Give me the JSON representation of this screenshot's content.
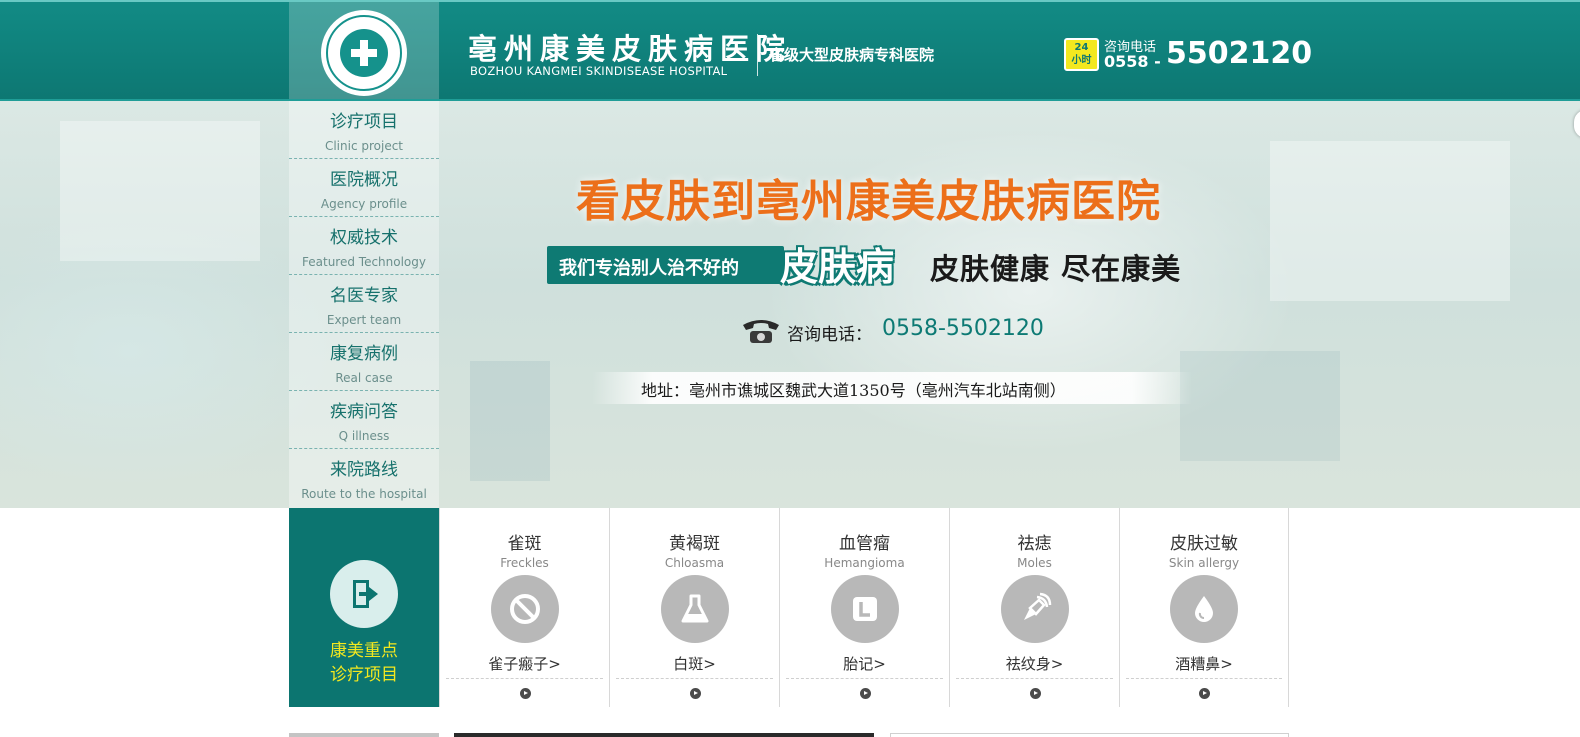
{
  "header": {
    "title_cn": "亳州康美皮肤病医院",
    "title_en": "BOZHOU KANGMEI SKINDISEASE HOSPITAL",
    "subtitle": "省级大型皮肤病专科医院",
    "badge_top": "24",
    "badge_bottom": "小时",
    "hotline_label": "咨询电话",
    "hotline_code": "0558 -",
    "hotline_number": "5502120"
  },
  "nav": {
    "items": [
      {
        "cn": "诊疗项目",
        "en": "Clinic project"
      },
      {
        "cn": "医院概况",
        "en": "Agency profile"
      },
      {
        "cn": "权威技术",
        "en": "Featured Technology"
      },
      {
        "cn": "名医专家",
        "en": "Expert team"
      },
      {
        "cn": "康复病例",
        "en": "Real case"
      },
      {
        "cn": "疾病问答",
        "en": "Q illness"
      },
      {
        "cn": "来院路线",
        "en": "Route to the hospital"
      }
    ]
  },
  "banner": {
    "slogan_main": "看皮肤到亳州康美皮肤病医院",
    "slogan_left": "我们专治别人治不好的",
    "slogan_big": "皮肤病",
    "slogan_right": "皮肤健康 尽在康美",
    "phone_label": "咨询电话：",
    "phone_number": "0558-5502120",
    "address": "地址：亳州市谯城区魏武大道1350号（亳州汽车北站南侧）"
  },
  "feature": {
    "line1": "康美重点",
    "line2": "诊疗项目"
  },
  "services": [
    {
      "cn": "雀斑",
      "en": "Freckles",
      "sub": "雀子瘢子>",
      "icon": "ban-icon"
    },
    {
      "cn": "黄褐斑",
      "en": "Chloasma",
      "sub": "白斑>",
      "icon": "flask-icon"
    },
    {
      "cn": "血管瘤",
      "en": "Hemangioma",
      "sub": "胎记>",
      "icon": "letter-l-icon"
    },
    {
      "cn": "祛痣",
      "en": "Moles",
      "sub": "祛纹身>",
      "icon": "pen-nib-icon"
    },
    {
      "cn": "皮肤过敏",
      "en": "Skin allergy",
      "sub": "酒糟鼻>",
      "icon": "droplet-icon"
    }
  ],
  "colors": {
    "teal": "#0d7772",
    "orange": "#ec6f1a",
    "yellow": "#f3e81f",
    "gray_circle": "#b8b8b8"
  }
}
